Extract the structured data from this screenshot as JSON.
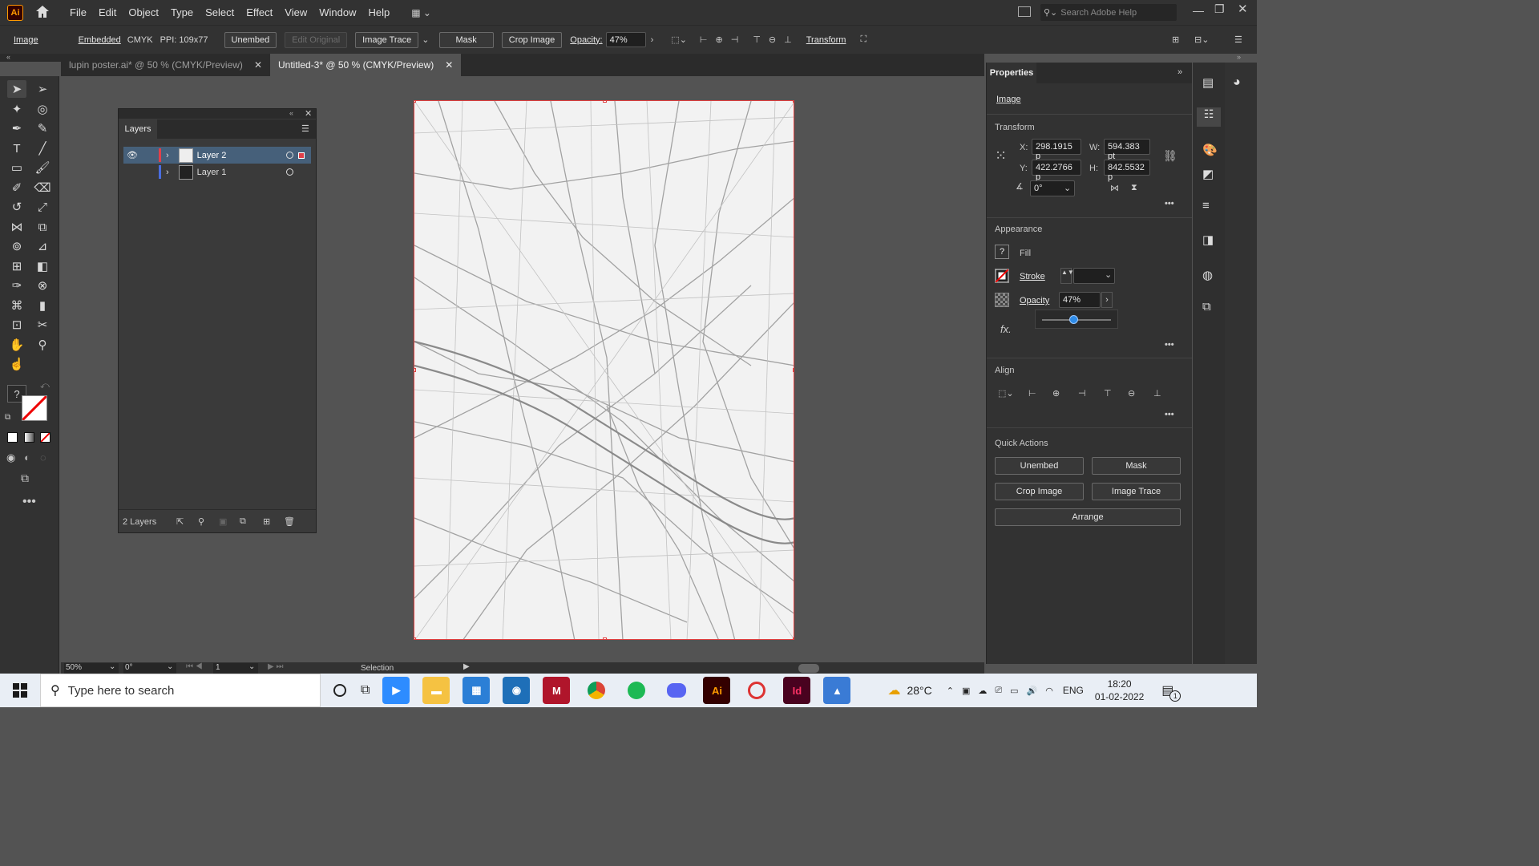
{
  "app": {
    "logo": "Ai"
  },
  "menu": [
    "File",
    "Edit",
    "Object",
    "Type",
    "Select",
    "Effect",
    "View",
    "Window",
    "Help"
  ],
  "search": {
    "placeholder": "Search Adobe Help"
  },
  "control": {
    "image_label": "Image",
    "embedded": "Embedded",
    "cmyk": "CMYK",
    "ppi": "PPI: 109x77",
    "unembed": "Unembed",
    "edit_original": "Edit Original",
    "image_trace": "Image Trace",
    "mask": "Mask",
    "crop_image": "Crop Image",
    "opacity_label": "Opacity:",
    "opacity_value": "47%",
    "transform": "Transform"
  },
  "tabs": [
    {
      "label": "lupin poster.ai* @ 50 % (CMYK/Preview)"
    },
    {
      "label": "Untitled-3* @ 50 % (CMYK/Preview)"
    }
  ],
  "layers": {
    "title": "Layers",
    "rows": [
      {
        "name": "Layer 2"
      },
      {
        "name": "Layer 1"
      }
    ],
    "count": "2 Layers"
  },
  "properties": {
    "title": "Properties",
    "type": "Image",
    "transform_title": "Transform",
    "x_label": "X:",
    "x": "298.1915 p",
    "y_label": "Y:",
    "y": "422.2766 p",
    "w_label": "W:",
    "w": "594.383 pt",
    "h_label": "H:",
    "h": "842.5532 p",
    "angle": "0°",
    "appearance_title": "Appearance",
    "fill": "Fill",
    "stroke": "Stroke",
    "opacity_label": "Opacity",
    "opacity": "47%",
    "fx": "fx.",
    "align_title": "Align",
    "quick_title": "Quick Actions",
    "unembed": "Unembed",
    "mask": "Mask",
    "crop": "Crop Image",
    "trace": "Image Trace",
    "arrange": "Arrange"
  },
  "status": {
    "zoom": "50%",
    "rotate": "0°",
    "page": "1",
    "tool": "Selection"
  },
  "taskbar": {
    "search_placeholder": "Type here to search",
    "weather": "28°C",
    "lang": "ENG",
    "time": "18:20",
    "date": "01-02-2022",
    "notifications": "1"
  },
  "opacity_fraction": 0.47
}
